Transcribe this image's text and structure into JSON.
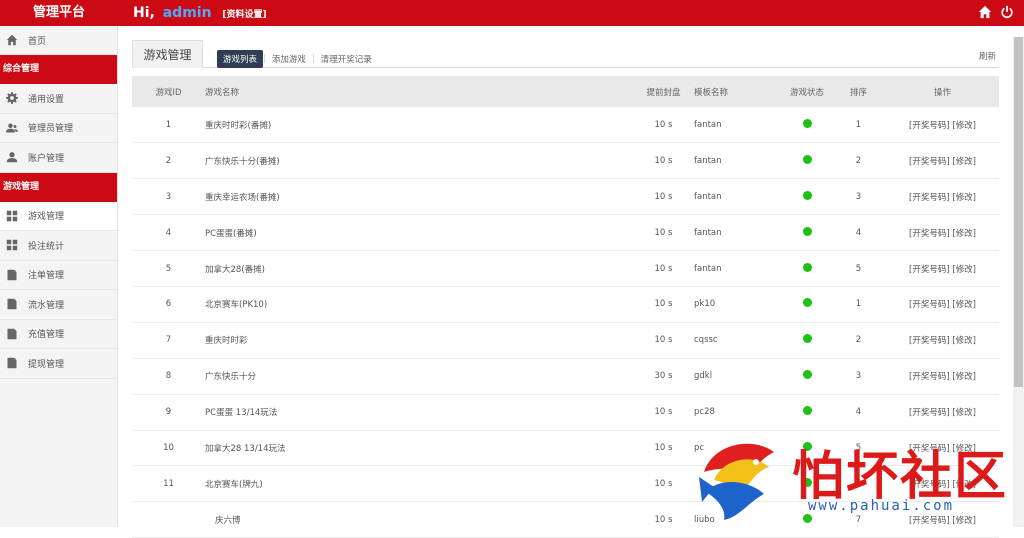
{
  "header": {
    "brand": "管理平台",
    "greeting": "Hi,",
    "username": "admin",
    "profile_link": "[资料设置]",
    "icons": [
      "home-icon",
      "power-icon"
    ]
  },
  "sidebar": {
    "home": "首页",
    "group1": "综合管理",
    "general_settings": "通用设置",
    "admin_manage": "管理员管理",
    "account_manage": "账户管理",
    "group2": "游戏管理",
    "game_manage": "游戏管理",
    "bet_stats": "投注统计",
    "order_manage": "注单管理",
    "flow_manage": "流水管理",
    "recharge_manage": "充值管理",
    "withdraw_manage": "提现管理"
  },
  "main": {
    "page_tab": "游戏管理",
    "subtabs": {
      "list": "游戏列表",
      "add": "添加游戏",
      "clear": "清理开奖记录"
    },
    "refresh": "刷新"
  },
  "table": {
    "headers": {
      "id": "游戏ID",
      "name": "游戏名称",
      "seal": "提前封盘",
      "template": "模板名称",
      "status": "游戏状态",
      "sort": "排序",
      "ops": "操作"
    },
    "rows": [
      {
        "id": "1",
        "name": "重庆时时彩(番摊)",
        "seal": "10 s",
        "template": "fantan",
        "sort": "1",
        "op1": "[开奖号码]",
        "op2": "[修改]"
      },
      {
        "id": "2",
        "name": "广东快乐十分(番摊)",
        "seal": "10 s",
        "template": "fantan",
        "sort": "2",
        "op1": "[开奖号码]",
        "op2": "[修改]"
      },
      {
        "id": "3",
        "name": "重庆幸运农场(番摊)",
        "seal": "10 s",
        "template": "fantan",
        "sort": "3",
        "op1": "[开奖号码]",
        "op2": "[修改]"
      },
      {
        "id": "4",
        "name": "PC蛋蛋(番摊)",
        "seal": "10 s",
        "template": "fantan",
        "sort": "4",
        "op1": "[开奖号码]",
        "op2": "[修改]"
      },
      {
        "id": "5",
        "name": "加拿大28(番摊)",
        "seal": "10 s",
        "template": "fantan",
        "sort": "5",
        "op1": "[开奖号码]",
        "op2": "[修改]"
      },
      {
        "id": "6",
        "name": "北京赛车(PK10)",
        "seal": "10 s",
        "template": "pk10",
        "sort": "1",
        "op1": "[开奖号码]",
        "op2": "[修改]"
      },
      {
        "id": "7",
        "name": "重庆时时彩",
        "seal": "10 s",
        "template": "cqssc",
        "sort": "2",
        "op1": "[开奖号码]",
        "op2": "[修改]"
      },
      {
        "id": "8",
        "name": "广东快乐十分",
        "seal": "30 s",
        "template": "gdkl",
        "sort": "3",
        "op1": "[开奖号码]",
        "op2": "[修改]"
      },
      {
        "id": "9",
        "name": "PC蛋蛋 13/14玩法",
        "seal": "10 s",
        "template": "pc28",
        "sort": "4",
        "op1": "[开奖号码]",
        "op2": "[修改]"
      },
      {
        "id": "10",
        "name": "加拿大28 13/14玩法",
        "seal": "10 s",
        "template": "pc",
        "sort": "5",
        "op1": "[开奖号码]",
        "op2": "[修改]"
      },
      {
        "id": "11",
        "name": "北京赛车(牌九)",
        "seal": "10 s",
        "template": "",
        "sort": "6",
        "op1": "[开奖号码]",
        "op2": "[修改]"
      },
      {
        "id": "",
        "name": "庆六博",
        "seal": "10 s",
        "template": "liubo",
        "sort": "7",
        "op1": "[开奖号码]",
        "op2": "[修改]"
      }
    ]
  },
  "watermark": {
    "text": "怕坏社区",
    "url": "www.pahuai.com"
  },
  "colors": {
    "brand_red": "#cc0a14",
    "status_green": "#19c213",
    "username_blue": "#4ea8ff"
  }
}
